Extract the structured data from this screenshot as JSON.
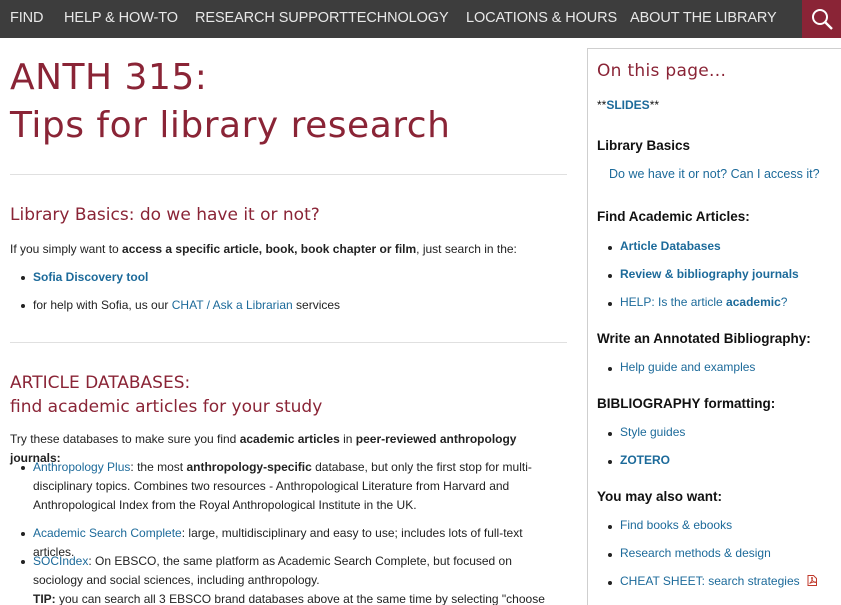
{
  "nav": {
    "items": [
      "FIND",
      "HELP & HOW-TO",
      "RESEARCH SUPPORT",
      "TECHNOLOGY",
      "LOCATIONS & HOURS",
      "ABOUT THE LIBRARY"
    ]
  },
  "page": {
    "title_line1": "ANTH 315:",
    "title_line2": "Tips for library research"
  },
  "basics": {
    "heading": "Library Basics: do we have it or not?",
    "intro_pre": "If you simply want to ",
    "intro_bold": "access a specific article, book, book chapter or film",
    "intro_post": ", just search in the:",
    "bullet1_link": "Sofia Discovery tool",
    "bullet2_pre": "for help with Sofia, us our ",
    "bullet2_link1": "CHAT",
    "bullet2_sep": " / ",
    "bullet2_link2": "Ask a Librarian",
    "bullet2_post": " services"
  },
  "databases": {
    "heading_line1": "ARTICLE DATABASES:",
    "heading_line2": "find academic articles for your study",
    "intro_pre": "Try these databases to make sure you find ",
    "intro_bold1": "academic articles",
    "intro_mid": " in ",
    "intro_bold2": "peer-reviewed anthropology journals:",
    "item1_link": "Anthropology Plus",
    "item1_pre": ": the most ",
    "item1_bold": "anthropology-specific",
    "item1_post": " database, but only the first stop for multi-disciplinary topics. Combines two resources - Anthropological Literature from Harvard and Anthropological Index from the Royal Anthropological Institute in the UK.",
    "item2_link": "Academic Search Complete",
    "item2_post": ": large, multidisciplinary and easy to use; includes lots of full-text articles.",
    "item3_link": "SOCIndex",
    "item3_post": ": On EBSCO, the same platform as Academic Search Complete, but focused on sociology and social sciences, including anthropology.",
    "tip_label": "TIP:",
    "tip_text": " you can search all 3 EBSCO brand databases above at the same time by selecting \"choose"
  },
  "sidebar": {
    "title": "On this page...",
    "slides_pre": "**",
    "slides_link": "SLIDES",
    "slides_post": "**",
    "basics_head": "Library Basics",
    "basics_link": "Do we have it or not? Can I access it?",
    "articles_head": "Find Academic Articles:",
    "articles_items": [
      "Article Databases",
      "Review & bibliography journals"
    ],
    "help_pre": "HELP: Is the article ",
    "help_bold": "academic",
    "help_post": "?",
    "annot_head": "Write an Annotated Bibliography:",
    "annot_items": [
      "Help guide and examples"
    ],
    "biblio_head": "BIBLIOGRAPHY formatting:",
    "biblio_items": [
      "Style guides",
      "ZOTERO"
    ],
    "also_head": "You may also want:",
    "also_items": [
      "Find books & ebooks",
      "Research methods & design",
      "CHEAT SHEET: search strategies"
    ]
  },
  "colors": {
    "accent": "#8a2436",
    "link": "#1c6a9a",
    "nav_bg": "#3d3d3d"
  }
}
